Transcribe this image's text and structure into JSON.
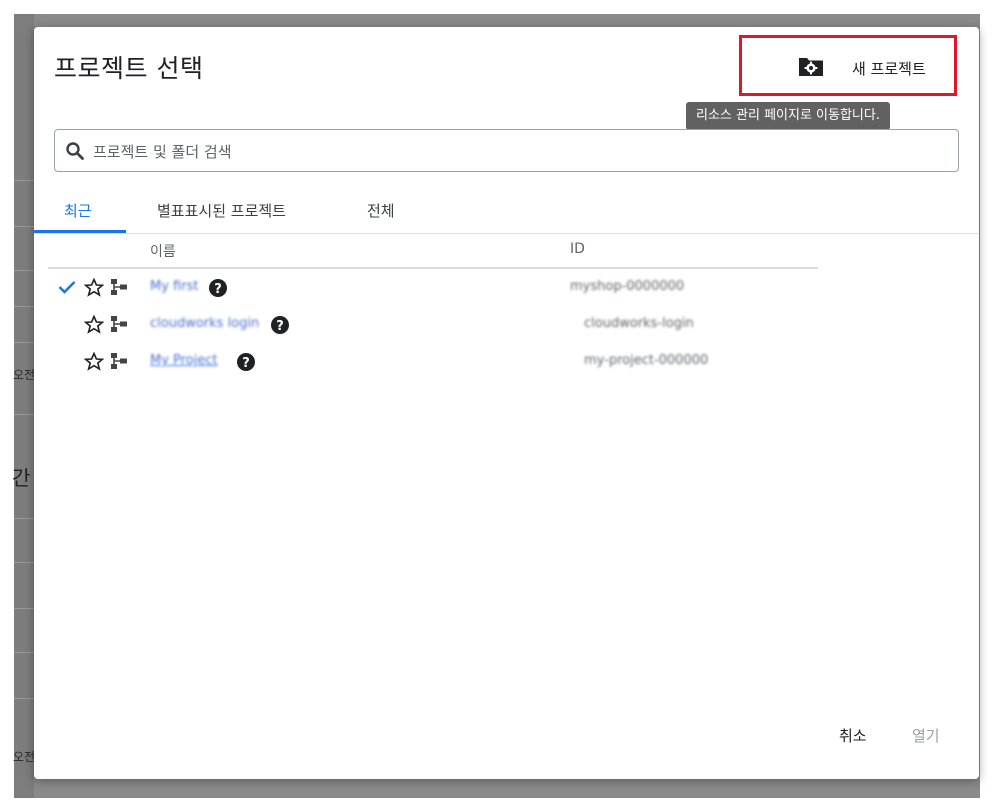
{
  "background": {
    "side_text_1": "오전",
    "side_text_2": "간",
    "side_text_3": "오전"
  },
  "dialog": {
    "title": "프로젝트 선택",
    "new_project_label": "새 프로젝트",
    "tooltip": "리소스 관리 페이지로 이동합니다.",
    "search_placeholder": "프로젝트 및 폴더 검색",
    "tabs": [
      {
        "label": "최근",
        "active": true
      },
      {
        "label": "별표표시된 프로젝트",
        "active": false
      },
      {
        "label": "전체",
        "active": false
      }
    ],
    "columns": {
      "name": "이름",
      "id": "ID"
    },
    "rows": [
      {
        "name": "My first",
        "id": "myshop-0000000",
        "selected": true
      },
      {
        "name": "cloudworks login",
        "id": "cloudworks-login",
        "selected": false
      },
      {
        "name": "My Project",
        "id": "my-project-000000",
        "selected": false
      }
    ],
    "cancel_label": "취소",
    "open_label": "열기"
  },
  "colors": {
    "accent": "#1a73e8",
    "highlight_box": "#e0162b",
    "tooltip_bg": "#616161"
  }
}
